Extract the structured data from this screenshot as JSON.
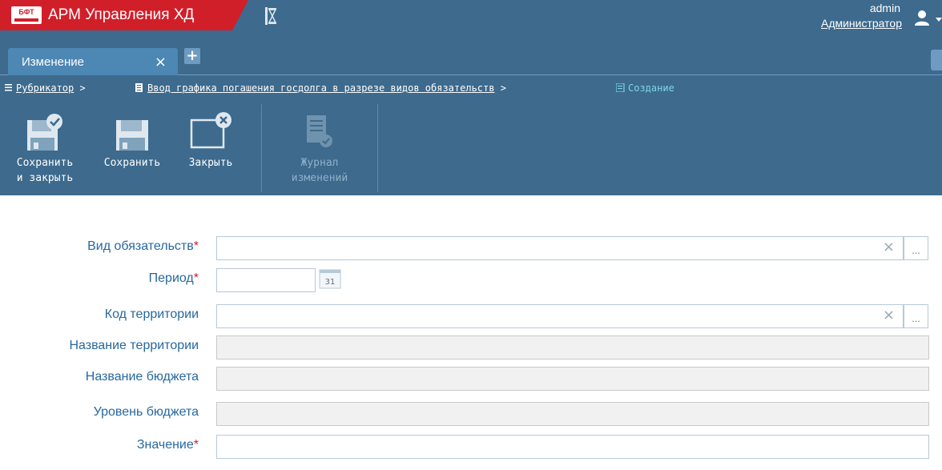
{
  "app": {
    "logo_text": "БФТ",
    "title": "АРМ Управления ХД"
  },
  "user": {
    "name": "admin",
    "role": "Администратор"
  },
  "tabs": [
    {
      "label": "Изменение",
      "close_glyph": "×"
    }
  ],
  "add_tab_glyph": "+",
  "breadcrumb": {
    "items": [
      {
        "label": "Рубрикатор",
        "sep": ">"
      },
      {
        "label": "Ввод графика погашения госдолга в разрезе видов обязательств",
        "sep": ">"
      },
      {
        "label": "Создание"
      }
    ]
  },
  "toolbar": {
    "save_close_line1": "Сохранить",
    "save_close_line2": "и закрыть",
    "save": "Сохранить",
    "close": "Закрыть",
    "journal_line1": "Журнал",
    "journal_line2": "изменений"
  },
  "form": {
    "required_mark": "*",
    "clear_glyph": "×",
    "dots_glyph": "...",
    "calendar_day": "31",
    "fields": {
      "obligation_type": {
        "label": "Вид обязательств",
        "value": ""
      },
      "period": {
        "label": "Период",
        "value": ""
      },
      "territory_code": {
        "label": "Код территории",
        "value": ""
      },
      "territory_name": {
        "label": "Название территории",
        "value": ""
      },
      "budget_name": {
        "label": "Название бюджета",
        "value": ""
      },
      "budget_level": {
        "label": "Уровень бюджета",
        "value": ""
      },
      "value": {
        "label": "Значение",
        "value": ""
      }
    }
  },
  "colors": {
    "header_bg": "#3d6a8d",
    "brand_red": "#d11f2a",
    "label_blue": "#27689f",
    "breadcrumb_current": "#7fd6e6"
  },
  "icons": {
    "brand": "bft-logo-icon",
    "hourglass": "hourglass-icon",
    "user": "user-icon",
    "caret": "chevron-down-icon",
    "save_close": "save-check-icon",
    "save": "save-icon",
    "close": "window-close-icon",
    "journal": "journal-icon",
    "calendar": "calendar-icon"
  }
}
